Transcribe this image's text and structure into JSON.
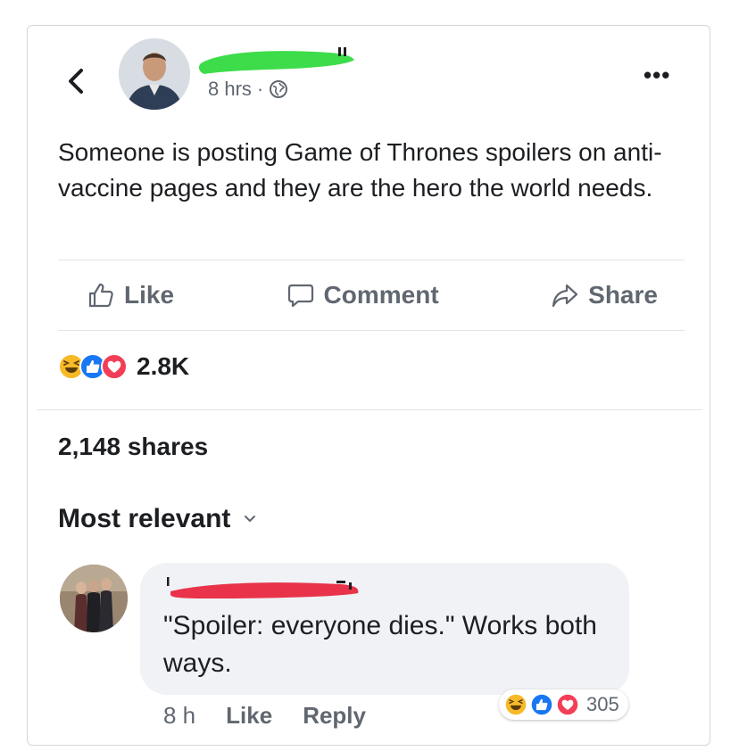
{
  "post": {
    "time": "8 hrs",
    "separator": "·",
    "text": "Someone is posting Game of Thrones spoilers on anti-vaccine pages and they are the hero the world needs."
  },
  "actions": {
    "like": "Like",
    "comment": "Comment",
    "share": "Share"
  },
  "stats": {
    "reactions_count": "2.8K",
    "shares": "2,148 shares"
  },
  "sort": {
    "label": "Most relevant"
  },
  "comment": {
    "text": "\"Spoiler: everyone dies.\" Works both ways.",
    "time": "8 h",
    "like": "Like",
    "reply": "Reply",
    "reactions_count": "305"
  },
  "colors": {
    "redaction_green": "#3ddc4a",
    "redaction_red": "#e8334a",
    "like_blue": "#1877f2",
    "love_red": "#f33e58",
    "haha_yellow": "#f7b928",
    "muted_text": "#606770"
  },
  "icons": {
    "back": "chevron-left-icon",
    "globe": "globe-icon",
    "more": "more-icon",
    "like": "thumbs-up-icon",
    "comment": "speech-bubble-icon",
    "share": "share-arrow-icon",
    "chevron": "chevron-down-icon"
  }
}
